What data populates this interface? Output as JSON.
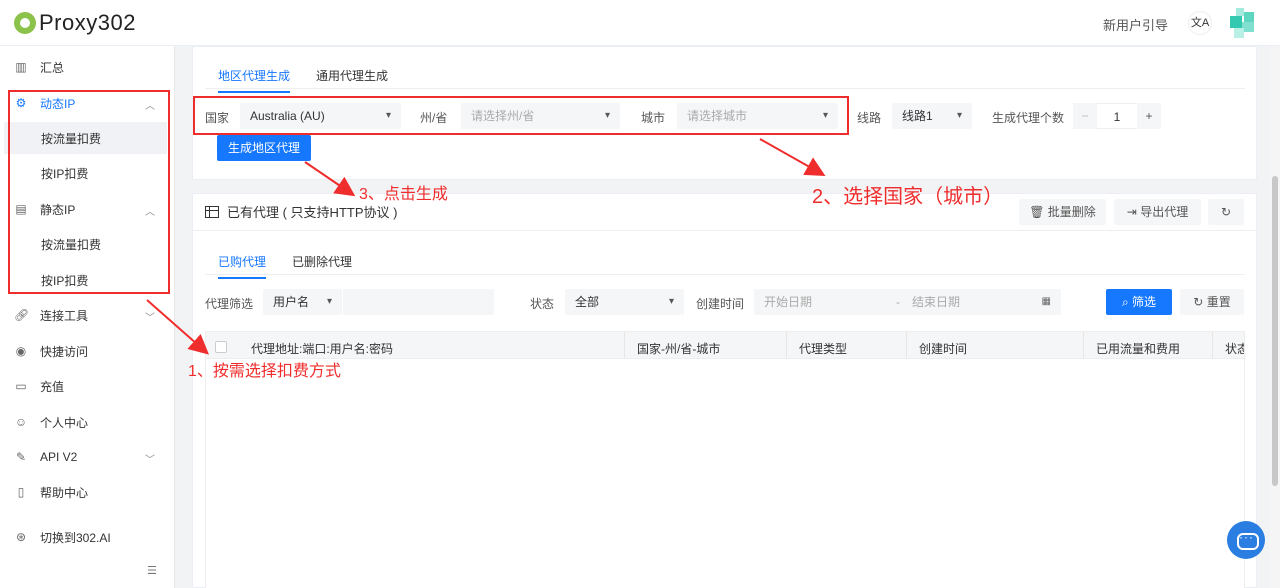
{
  "header": {
    "logo_text": "Proxy302",
    "guide_link": "新用户引导",
    "lang_icon": "translate-icon"
  },
  "sidebar": {
    "items": [
      {
        "label": "汇总",
        "icon": "bar-chart-icon"
      },
      {
        "label": "动态IP",
        "icon": "gear-icon"
      },
      {
        "label": "按流量扣费"
      },
      {
        "label": "按IP扣费"
      },
      {
        "label": "静态IP",
        "icon": "server-icon"
      },
      {
        "label": "按流量扣费"
      },
      {
        "label": "按IP扣费"
      },
      {
        "label": "连接工具",
        "icon": "link-icon"
      },
      {
        "label": "快捷访问",
        "icon": "chrome-icon"
      },
      {
        "label": "充值",
        "icon": "card-icon"
      },
      {
        "label": "个人中心",
        "icon": "user-icon"
      },
      {
        "label": "API V2",
        "icon": "api-icon"
      },
      {
        "label": "帮助中心",
        "icon": "book-icon"
      },
      {
        "label": "切换到302.AI",
        "icon": "switch-icon"
      }
    ]
  },
  "generator": {
    "tabs": [
      "地区代理生成",
      "通用代理生成"
    ],
    "country_label": "国家",
    "country_value": "Australia (AU)",
    "state_label": "州/省",
    "state_placeholder": "请选择州/省",
    "city_label": "城市",
    "city_placeholder": "请选择城市",
    "route_label": "线路",
    "route_value": "线路1",
    "count_label": "生成代理个数",
    "count_value": "1",
    "generate_button": "生成地区代理"
  },
  "proxies": {
    "title": "已有代理 ( 只支持HTTP协议 )",
    "batch_delete": "批量删除",
    "export": "导出代理",
    "tabs": [
      "已购代理",
      "已删除代理"
    ],
    "filter_label": "代理筛选",
    "filter_field": "用户名",
    "status_label": "状态",
    "status_value": "全部",
    "created_label": "创建时间",
    "start_placeholder": "开始日期",
    "range_sep": "-",
    "end_placeholder": "结束日期",
    "filter_button": "筛选",
    "reset_button": "重置",
    "columns": [
      "代理地址:端口:用户名:密码",
      "国家-州/省-城市",
      "代理类型",
      "创建时间",
      "已用流量和费用",
      "状态"
    ]
  },
  "annotations": {
    "step1": "1、按需选择扣费方式",
    "step2": "2、选择国家（城市）",
    "step3": "3、点击生成"
  },
  "colors": {
    "primary": "#1677ff",
    "annotation": "#f02d2d"
  }
}
